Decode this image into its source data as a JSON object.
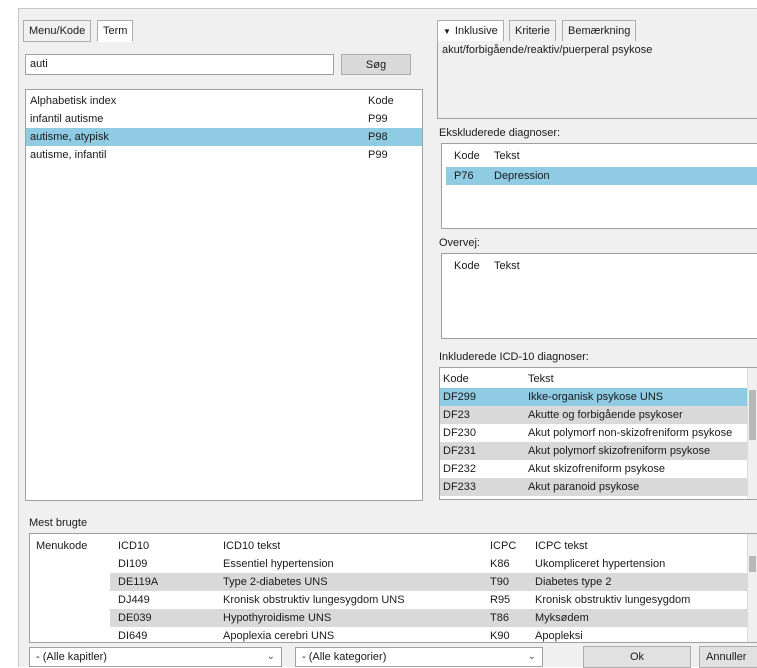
{
  "colors": {
    "selection": "#8fcbe3",
    "stripe": "#d9d9d9",
    "window": "#f0f0f0"
  },
  "left_tabs": [
    "Menu/Kode",
    "Term"
  ],
  "search": {
    "value": "auti",
    "button": "Søg"
  },
  "index_list": {
    "headers": [
      "Alphabetisk index",
      "Kode"
    ],
    "rows": [
      {
        "term": "infantil autisme",
        "code": "P99"
      },
      {
        "term": "autisme, atypisk",
        "code": "P98",
        "selected": true
      },
      {
        "term": "autisme, infantil",
        "code": "P99"
      }
    ]
  },
  "right_tabs": [
    "Inklusive",
    "Kriterie",
    "Bemærkning"
  ],
  "right_tab_arrow_icon": "triangle-down-icon",
  "inklusive_text": "akut/forbigående/reaktiv/puerperal psykose",
  "ekskluderede": {
    "label": "Ekskluderede diagnoser:",
    "headers": [
      "Kode",
      "Tekst"
    ],
    "rows": [
      {
        "code": "P76",
        "text": "Depression"
      }
    ]
  },
  "overvej": {
    "label": "Overvej:",
    "headers": [
      "Kode",
      "Tekst"
    ]
  },
  "icd10": {
    "label": "Inkluderede ICD-10 diagnoser:",
    "headers": [
      "Kode",
      "Tekst"
    ],
    "rows": [
      {
        "code": "DF299",
        "text": "Ikke-organisk psykose UNS"
      },
      {
        "code": "DF23",
        "text": "Akutte og forbigående psykoser"
      },
      {
        "code": "DF230",
        "text": "Akut polymorf non-skizofreniform psykose"
      },
      {
        "code": "DF231",
        "text": "Akut polymorf skizofreniform psykose"
      },
      {
        "code": "DF232",
        "text": "Akut skizofreniform psykose"
      },
      {
        "code": "DF233",
        "text": "Akut paranoid psykose"
      }
    ]
  },
  "mest_brugte": {
    "title": "Mest brugte",
    "headers": {
      "menukode": "Menukode",
      "icd10": "ICD10",
      "icd10_text": "ICD10 tekst",
      "icpc": "ICPC",
      "icpc_text": "ICPC tekst"
    },
    "rows": [
      {
        "icd10": "DI109",
        "icd10_text": "Essentiel hypertension",
        "icpc": "K86",
        "icpc_text": "Ukompliceret hypertension"
      },
      {
        "icd10": "DE119A",
        "icd10_text": "Type 2-diabetes UNS",
        "icpc": "T90",
        "icpc_text": "Diabetes type 2"
      },
      {
        "icd10": "DJ449",
        "icd10_text": "Kronisk obstruktiv lungesygdom UNS",
        "icpc": "R95",
        "icpc_text": "Kronisk obstruktiv lungesygdom"
      },
      {
        "icd10": "DE039",
        "icd10_text": "Hypothyroidisme UNS",
        "icpc": "T86",
        "icpc_text": "Myksødem"
      },
      {
        "icd10": "DI649",
        "icd10_text": "Apoplexia cerebri UNS",
        "icpc": "K90",
        "icpc_text": "Apopleksi"
      }
    ]
  },
  "footer": {
    "kapitler": "- (Alle kapitler)",
    "kategorier": "- (Alle kategorier)",
    "ok": "Ok",
    "annuller": "Annuller"
  }
}
